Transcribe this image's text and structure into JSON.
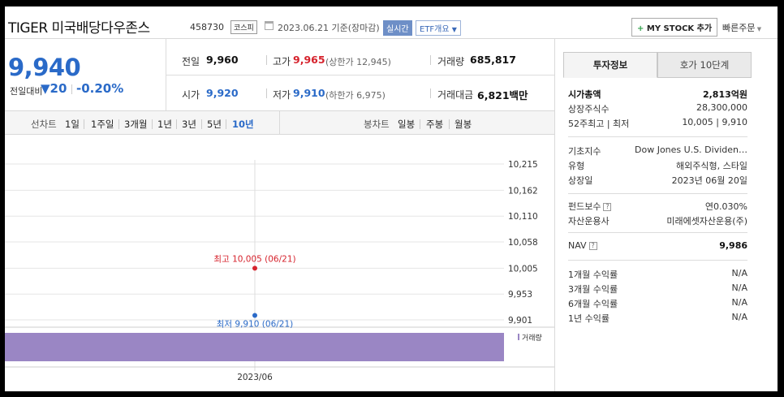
{
  "header": {
    "stock_name": "TIGER 미국배당다우존스",
    "stock_code": "458730",
    "market": "코스피",
    "date_text": "2023.06.21 기준(장마감)",
    "realtime_label": "실시간",
    "etf_label": "ETF개요",
    "mystock_plus": "+",
    "mystock_label": "MY STOCK 추가",
    "quick_order": "빠른주문"
  },
  "price": {
    "current": "9,940",
    "compare_label": "전일대비",
    "change_arrow": "▼",
    "change": "20",
    "change_rate": "-0.20%"
  },
  "summary": {
    "prev_close": {
      "label": "전일",
      "value": "9,960"
    },
    "high": {
      "label": "고가",
      "value": "9,965",
      "sub": "(상한가 12,945)"
    },
    "volume": {
      "label": "거래량",
      "value": "685,817"
    },
    "open": {
      "label": "시가",
      "value": "9,920"
    },
    "low": {
      "label": "저가",
      "value": "9,910",
      "sub": "(하한가 6,975)"
    },
    "amount": {
      "label": "거래대금",
      "value": "6,821",
      "unit": "백만"
    }
  },
  "periods": {
    "line_label": "선차트",
    "items": [
      "1일",
      "1주일",
      "3개월",
      "1년",
      "3년",
      "5년",
      "10년"
    ],
    "selected": "10년",
    "candle_label": "봉차트",
    "candle_items": [
      "일봉",
      "주봉",
      "월봉"
    ]
  },
  "chart_data": {
    "type": "line",
    "y_ticks": [
      "10,215",
      "10,162",
      "10,110",
      "10,058",
      "10,005",
      "9,953",
      "9,901"
    ],
    "y_tick_values": [
      10215,
      10162,
      10110,
      10058,
      10005,
      9953,
      9901
    ],
    "x_ticks": [
      "2023/06"
    ],
    "points": [
      {
        "date": "06/21",
        "value": 10005,
        "kind": "high",
        "label": "최고 10,005 (06/21)"
      },
      {
        "date": "06/21",
        "value": 9910,
        "kind": "low",
        "label": "최저 9,910 (06/21)"
      }
    ],
    "volume_label": "거래량",
    "volume_color": "#9a86c4",
    "high_color": "#d6232d",
    "low_color": "#2a6ac8"
  },
  "panel": {
    "tab_info": "투자정보",
    "tab_quote": "호가 10단계",
    "market_cap": {
      "label": "시가총액",
      "value": "2,813억원"
    },
    "shares": {
      "label": "상장주식수",
      "value": "28,300,000"
    },
    "week52": {
      "label": "52주최고 | 최저",
      "value": "10,005 | 9,910"
    },
    "base_index": {
      "label": "기초지수",
      "value": "Dow Jones U.S. Dividen…"
    },
    "type": {
      "label": "유형",
      "value": "해외주식형, 스타일"
    },
    "listed": {
      "label": "상장일",
      "value": "2023년 06월 20일"
    },
    "fee": {
      "label": "펀드보수",
      "value": "연0.030%"
    },
    "manager": {
      "label": "자산운용사",
      "value": "미래에셋자산운용(주)"
    },
    "nav": {
      "label": "NAV",
      "value": "9,986"
    },
    "returns": [
      {
        "label": "1개월 수익률",
        "value": "N/A"
      },
      {
        "label": "3개월 수익률",
        "value": "N/A"
      },
      {
        "label": "6개월 수익률",
        "value": "N/A"
      },
      {
        "label": "1년 수익률",
        "value": "N/A"
      }
    ],
    "help_glyph": "?"
  }
}
